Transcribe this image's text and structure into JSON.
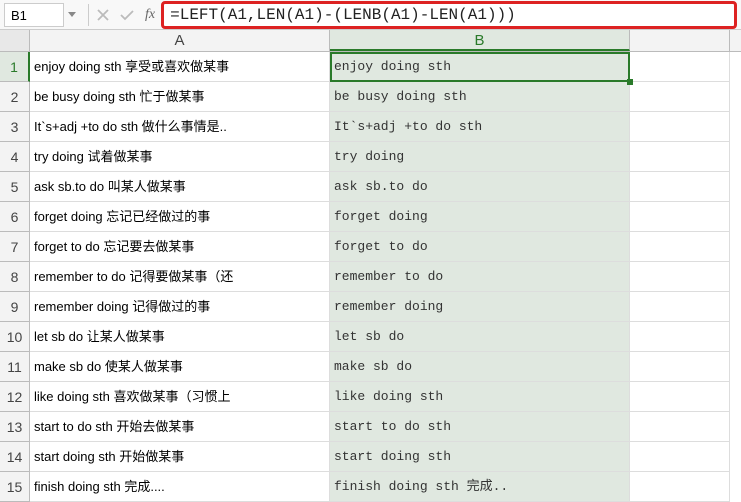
{
  "nameBox": "B1",
  "formula": "=LEFT(A1,LEN(A1)-(LENB(A1)-LEN(A1)))",
  "columns": [
    "A",
    "B"
  ],
  "selectedCell": {
    "row": 1,
    "col": "B"
  },
  "rows": [
    {
      "n": 1,
      "a": "enjoy doing sth 享受或喜欢做某事",
      "b": "enjoy doing sth"
    },
    {
      "n": 2,
      "a": "be busy doing sth 忙于做某事",
      "b": "be busy doing sth"
    },
    {
      "n": 3,
      "a": "It`s+adj +to do sth 做什么事情是..",
      "b": "It`s+adj +to do sth"
    },
    {
      "n": 4,
      "a": "try doing 试着做某事",
      "b": "try doing"
    },
    {
      "n": 5,
      "a": "ask sb.to do 叫某人做某事",
      "b": "ask sb.to do"
    },
    {
      "n": 6,
      "a": "forget doing 忘记已经做过的事",
      "b": "forget doing"
    },
    {
      "n": 7,
      "a": "forget to do 忘记要去做某事",
      "b": "forget to do"
    },
    {
      "n": 8,
      "a": "remember to do 记得要做某事（还",
      "b": "remember to do"
    },
    {
      "n": 9,
      "a": "remember doing 记得做过的事",
      "b": "remember doing"
    },
    {
      "n": 10,
      "a": "let sb do 让某人做某事",
      "b": "let sb do"
    },
    {
      "n": 11,
      "a": "make sb do 使某人做某事",
      "b": "make sb do"
    },
    {
      "n": 12,
      "a": "like doing sth 喜欢做某事（习惯上",
      "b": "like doing sth"
    },
    {
      "n": 13,
      "a": "start to do sth 开始去做某事",
      "b": "start to do sth"
    },
    {
      "n": 14,
      "a": "start doing sth 开始做某事",
      "b": "start doing sth"
    },
    {
      "n": 15,
      "a": "finish doing sth 完成....",
      "b": "finish doing sth 完成.."
    }
  ]
}
